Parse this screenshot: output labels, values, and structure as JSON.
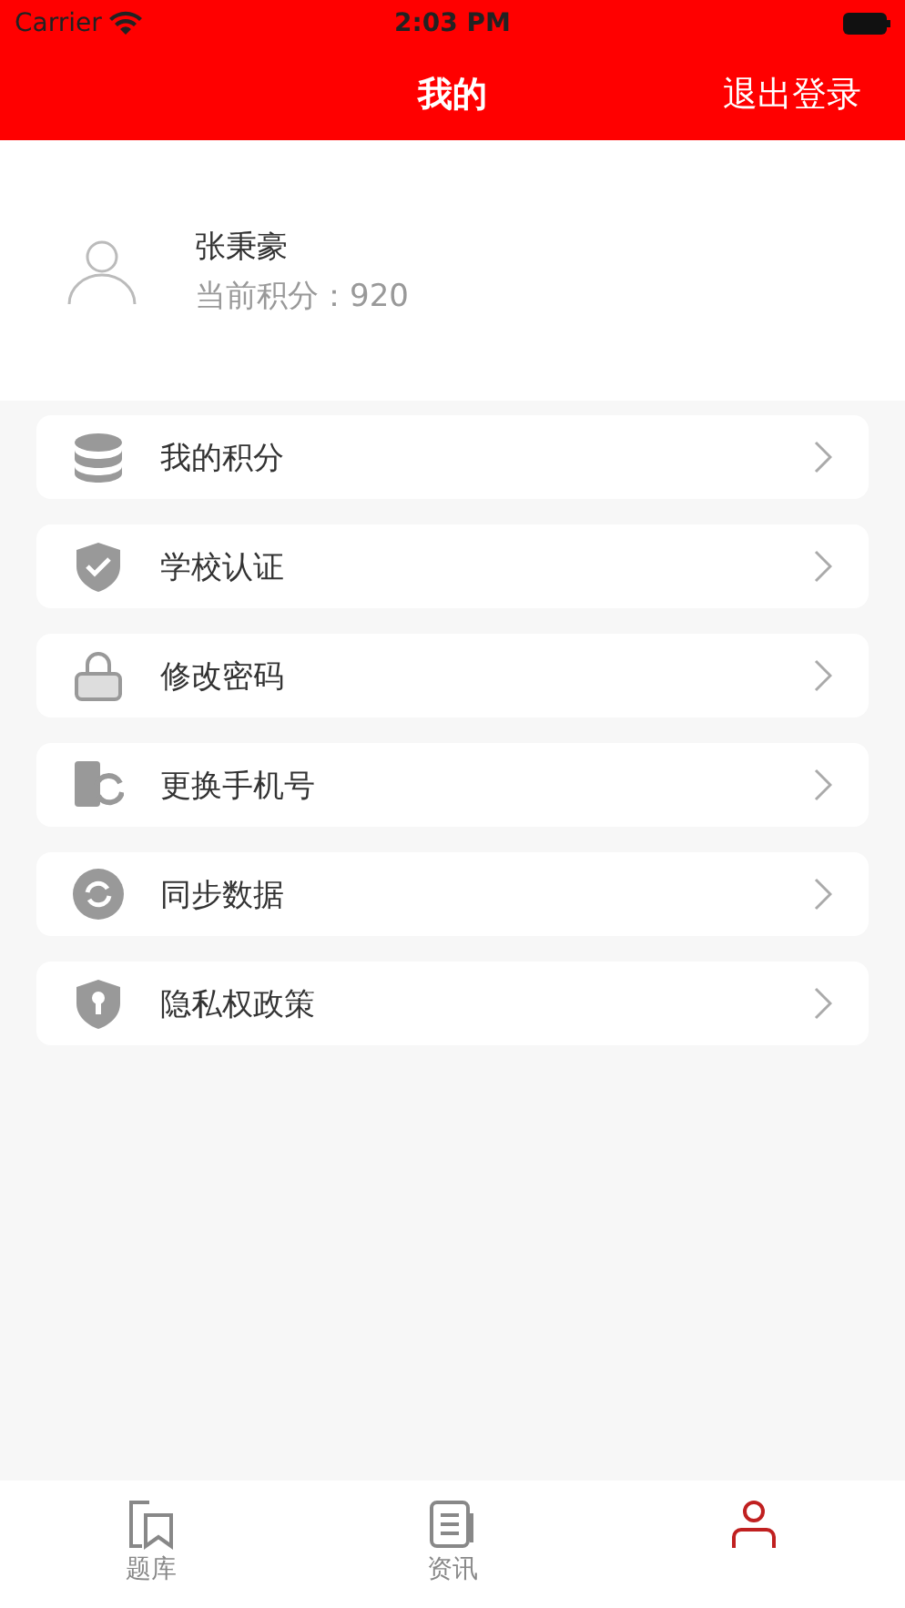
{
  "status_bar": {
    "carrier": "Carrier",
    "time": "2:03 PM"
  },
  "nav": {
    "title": "我的",
    "action": "退出登录"
  },
  "profile": {
    "name": "张秉豪",
    "points": "当前积分：920"
  },
  "menu": [
    {
      "kind": "coins",
      "label": "我的积分"
    },
    {
      "kind": "shield-check",
      "label": "学校认证"
    },
    {
      "kind": "lock",
      "label": "修改密码"
    },
    {
      "kind": "phone-swap",
      "label": "更换手机号"
    },
    {
      "kind": "sync",
      "label": "同步数据"
    },
    {
      "kind": "shield-key",
      "label": "隐私权政策"
    }
  ],
  "tabs": [
    {
      "kind": "bookmark",
      "label": "题库",
      "selected": false
    },
    {
      "kind": "news",
      "label": "资讯",
      "selected": false
    },
    {
      "kind": "person",
      "selected": true
    }
  ]
}
